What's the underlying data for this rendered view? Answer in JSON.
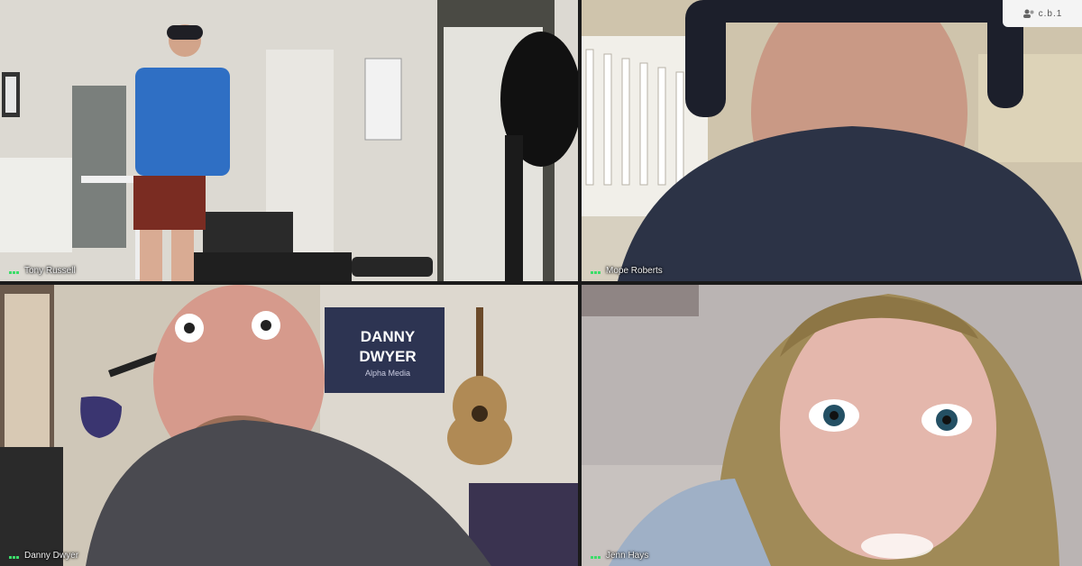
{
  "participants": [
    {
      "name": "Tony Russell"
    },
    {
      "name": "Mope Roberts"
    },
    {
      "name": "Danny Dwyer"
    },
    {
      "name": "Jenn Hays"
    }
  ],
  "banner": {
    "line1": "DANNY",
    "line2": "DWYER",
    "line3": "Alpha Media"
  },
  "corner_badge": "c.b.1"
}
